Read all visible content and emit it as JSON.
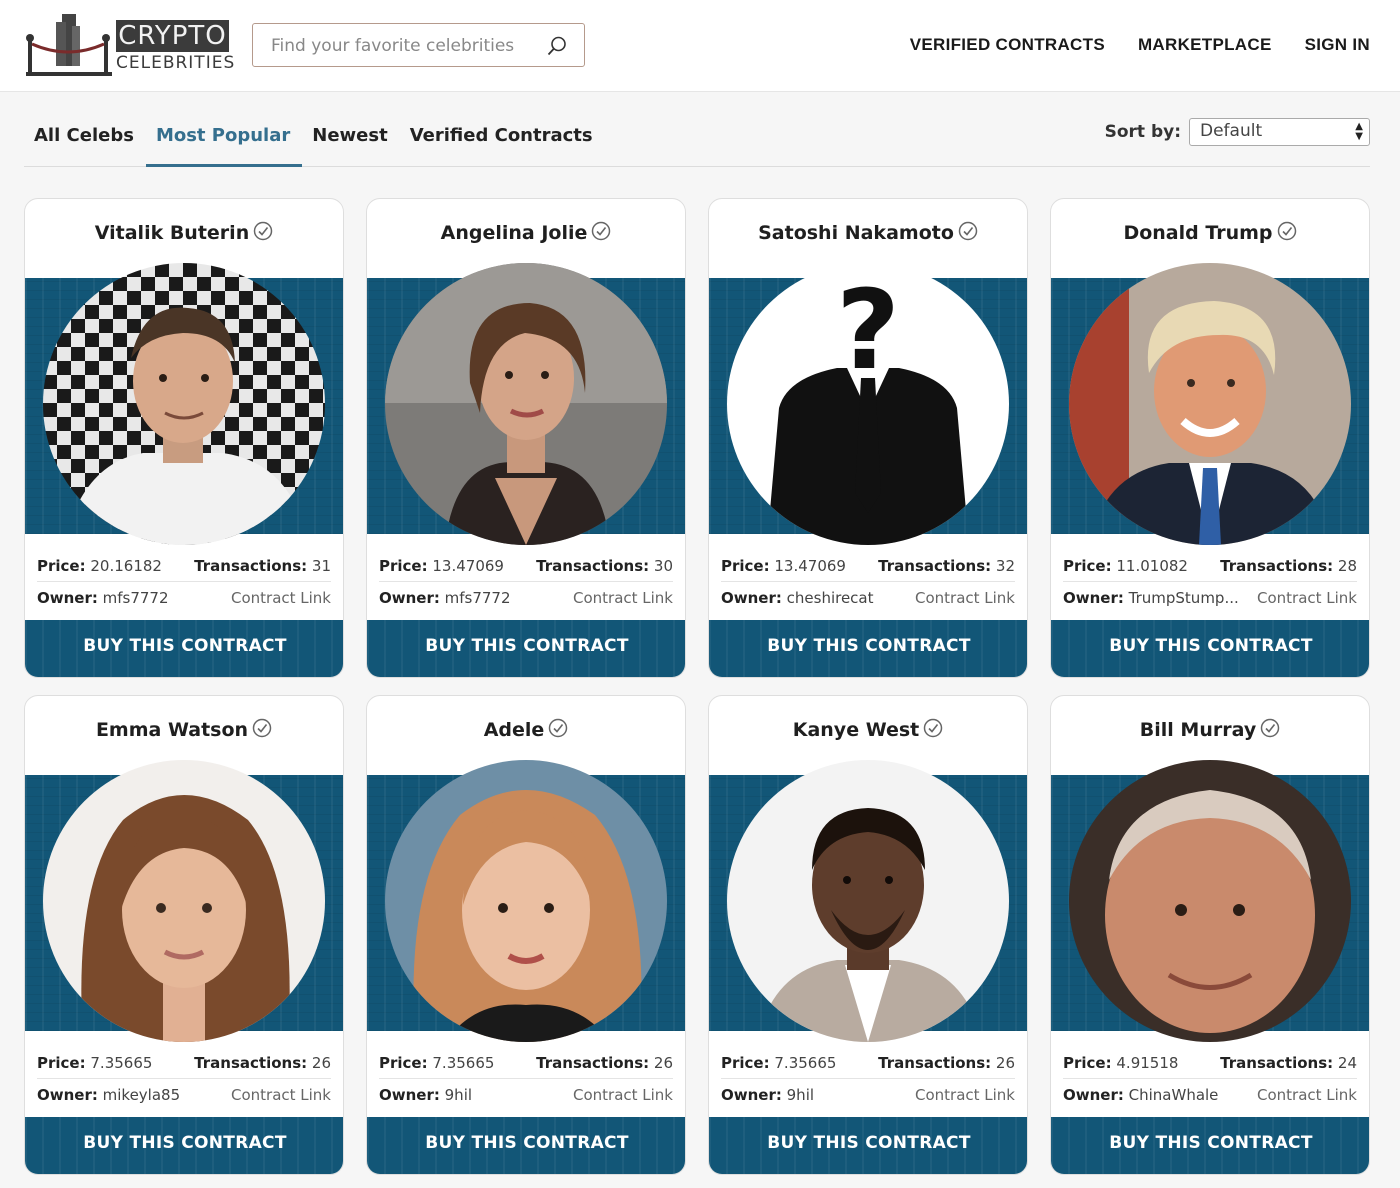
{
  "header": {
    "logo_line1": "CRYPTO",
    "logo_line2": "CELEBRITIES",
    "search_placeholder": "Find your favorite celebrities",
    "nav": [
      "VERIFIED CONTRACTS",
      "MARKETPLACE",
      "SIGN IN"
    ]
  },
  "tabs": [
    "All Celebs",
    "Most Popular",
    "Newest",
    "Verified Contracts"
  ],
  "active_tab": "Most Popular",
  "sort": {
    "label": "Sort by:",
    "value": "Default"
  },
  "card_labels": {
    "price": "Price:",
    "transactions": "Transactions:",
    "owner": "Owner:",
    "contract_link": "Contract Link",
    "buy": "BUY THIS CONTRACT"
  },
  "cards": [
    {
      "name": "Vitalik Buterin",
      "price": "20.16182",
      "transactions": "31",
      "owner": "mfs7772",
      "verified": true
    },
    {
      "name": "Angelina Jolie",
      "price": "13.47069",
      "transactions": "30",
      "owner": "mfs7772",
      "verified": true
    },
    {
      "name": "Satoshi Nakamoto",
      "price": "13.47069",
      "transactions": "32",
      "owner": "cheshirecat",
      "verified": true
    },
    {
      "name": "Donald Trump",
      "price": "11.01082",
      "transactions": "28",
      "owner": "TrumpStump...",
      "verified": true
    },
    {
      "name": "Emma Watson",
      "price": "7.35665",
      "transactions": "26",
      "owner": "mikeyla85",
      "verified": true
    },
    {
      "name": "Adele",
      "price": "7.35665",
      "transactions": "26",
      "owner": "9hil",
      "verified": true
    },
    {
      "name": "Kanye West",
      "price": "7.35665",
      "transactions": "26",
      "owner": "9hil",
      "verified": true
    },
    {
      "name": "Bill Murray",
      "price": "4.91518",
      "transactions": "24",
      "owner": "ChinaWhale",
      "verified": true
    }
  ],
  "colors": {
    "accent": "#125677",
    "tab_active": "#356f8e",
    "search_border": "#b59a8c"
  }
}
